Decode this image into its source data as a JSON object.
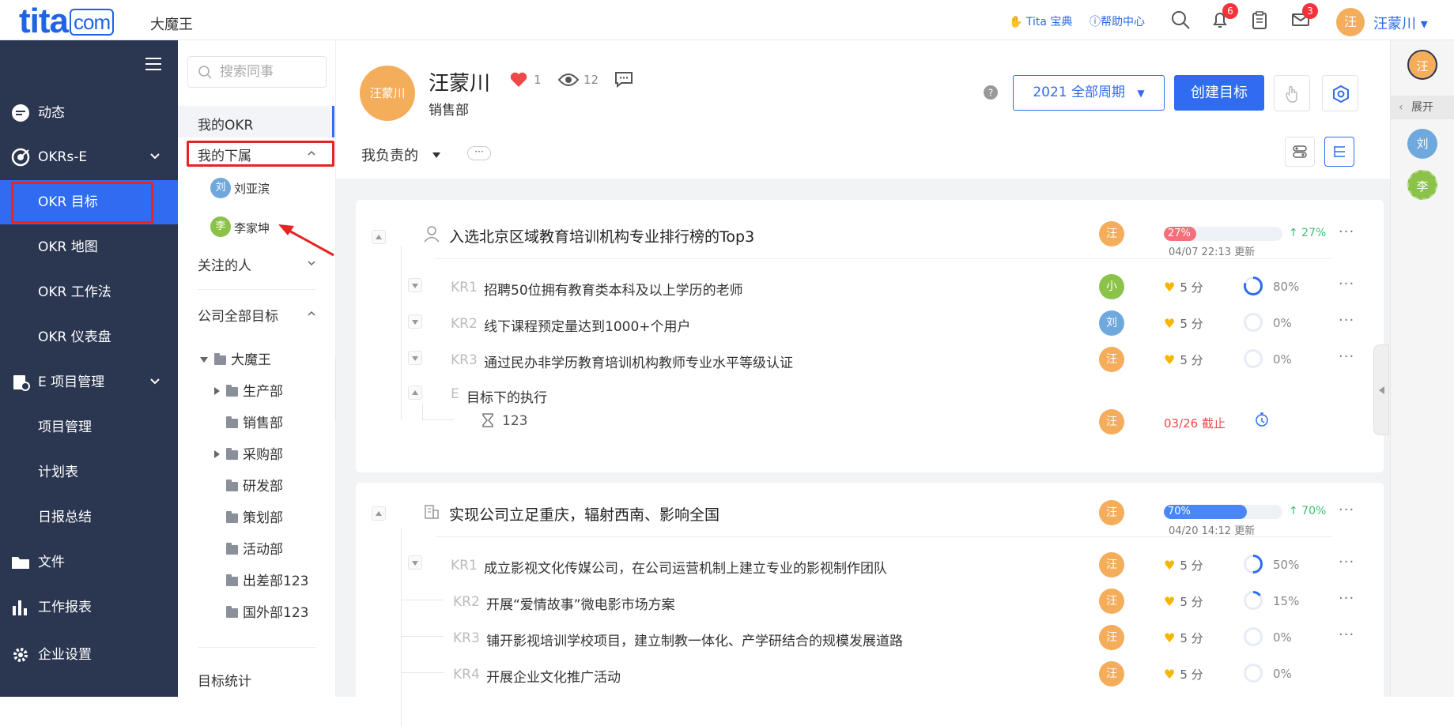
{
  "topbar": {
    "logo_main": "tita",
    "logo_suffix": "com",
    "company": "大魔王",
    "tita_book": "Tita 宝典",
    "help_center": "帮助中心",
    "notifications_count": "6",
    "messages_count": "3",
    "user_avatar": "汪",
    "user_name": "汪蒙川 ▾"
  },
  "leftnav": {
    "items": [
      {
        "label": "动态",
        "icon": "feed-icon"
      },
      {
        "label": "OKRs-E",
        "icon": "target-icon"
      },
      {
        "label": "OKR 目标"
      },
      {
        "label": "OKR 地图"
      },
      {
        "label": "OKR 工作法"
      },
      {
        "label": "OKR 仪表盘"
      },
      {
        "label": "E 项目管理",
        "icon": "project-icon"
      },
      {
        "label": "项目管理"
      },
      {
        "label": "计划表"
      },
      {
        "label": "日报总结"
      },
      {
        "label": "文件",
        "icon": "folder-icon"
      },
      {
        "label": "工作报表",
        "icon": "bar-chart-icon"
      },
      {
        "label": "企业设置",
        "icon": "gear-icon"
      }
    ]
  },
  "subpanel": {
    "search_placeholder": "搜索同事",
    "my_okr": "我的OKR",
    "my_subordinates": "我的下属",
    "sub1_avatar": "刘",
    "sub1_name": "刘亚滨",
    "sub2_avatar": "李",
    "sub2_name": "李家坤",
    "followed": "关注的人",
    "company_goals": "公司全部目标",
    "tree": [
      "大魔王",
      "生产部",
      "销售部",
      "采购部",
      "研发部",
      "策划部",
      "活动部",
      "出差部123",
      "国外部123"
    ],
    "goal_stats": "目标统计"
  },
  "header": {
    "avatar_text": "汪蒙川",
    "name": "汪蒙川",
    "dept": "销售部",
    "likes": "1",
    "views": "12",
    "period": "2021 全部周期",
    "create": "创建目标",
    "filter": "我负责的",
    "more": "···"
  },
  "objectives": [
    {
      "title": "入选北京区域教育培训机构专业排行榜的Top3",
      "owner": "汪",
      "progress": "27%",
      "progress_value": 27,
      "updated": "04/07 22:13 更新",
      "delta": "↑ 27%",
      "krs": [
        {
          "label": "KR1",
          "text": "招聘50位拥有教育类本科及以上学历的老师",
          "owner": "小",
          "owner_color": "#8bc34a",
          "score": "5 分",
          "pct": "80%",
          "pct_value": 80
        },
        {
          "label": "KR2",
          "text": "线下课程预定量达到1000+个用户",
          "owner": "刘",
          "owner_color": "#6fa8dc",
          "score": "5 分",
          "pct": "0%",
          "pct_value": 0
        },
        {
          "label": "KR3",
          "text": "通过民办非学历教育培训机构教师专业水平等级认证",
          "owner": "汪",
          "owner_color": "#f4ad5b",
          "score": "5 分",
          "pct": "0%",
          "pct_value": 0
        }
      ],
      "exec_label": "E",
      "exec_title": "目标下的执行",
      "task": {
        "name": "123",
        "owner": "汪",
        "due": "03/26 截止"
      }
    },
    {
      "title": "实现公司立足重庆，辐射西南、影响全国",
      "owner": "汪",
      "progress": "70%",
      "progress_value": 70,
      "updated": "04/20 14:12 更新",
      "delta": "↑ 70%",
      "krs": [
        {
          "label": "KR1",
          "text": "成立影视文化传媒公司，在公司运营机制上建立专业的影视制作团队",
          "owner": "汪",
          "owner_color": "#f4ad5b",
          "score": "5 分",
          "pct": "50%",
          "pct_value": 50
        },
        {
          "label": "KR2",
          "text": "开展“爱情故事”微电影市场方案",
          "owner": "汪",
          "owner_color": "#f4ad5b",
          "score": "5 分",
          "pct": "15%",
          "pct_value": 15
        },
        {
          "label": "KR3",
          "text": "铺开影视培训学校项目，建立制教一体化、产学研结合的规模发展道路",
          "owner": "汪",
          "owner_color": "#f4ad5b",
          "score": "5 分",
          "pct": "0%",
          "pct_value": 0
        },
        {
          "label": "KR4",
          "text": "开展企业文化推广活动",
          "owner": "汪",
          "owner_color": "#f4ad5b",
          "score": "5 分",
          "pct": "0%",
          "pct_value": 0
        }
      ]
    }
  ],
  "rightrail": {
    "top_avatar": "汪",
    "expand": "展开",
    "av1": "刘",
    "av2": "李"
  },
  "colors": {
    "primary": "#2f6cf0",
    "nav_bg": "#2b3651",
    "avatar_orange": "#f4ad5b",
    "progress_red": "#f2707a",
    "progress_blue": "#4a86f7",
    "highlight_red": "#e62424"
  }
}
